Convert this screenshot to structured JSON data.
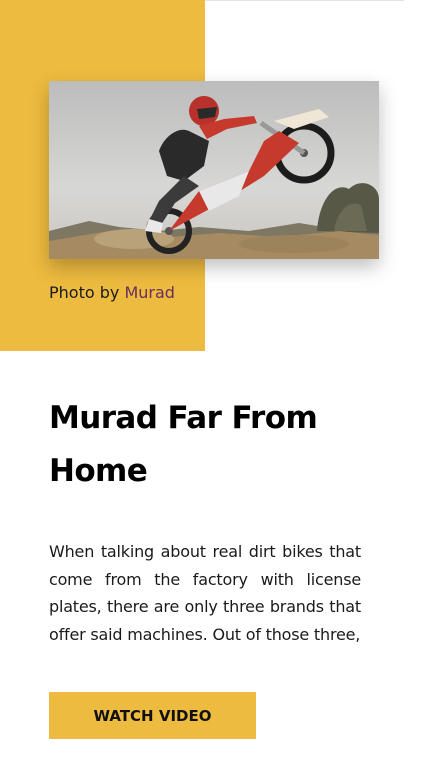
{
  "hero": {
    "credit_prefix": "Photo by",
    "credit_author": "Murad"
  },
  "article": {
    "title": "Murad Far From Home",
    "excerpt": "When talking about real dirt bikes that come from the factory with license plates, there are only three brands that offer said machines. Out of those three,"
  },
  "cta": {
    "label": "WATCH VIDEO"
  },
  "colors": {
    "accent": "#EDBB3F",
    "link": "#6B2C5F"
  }
}
